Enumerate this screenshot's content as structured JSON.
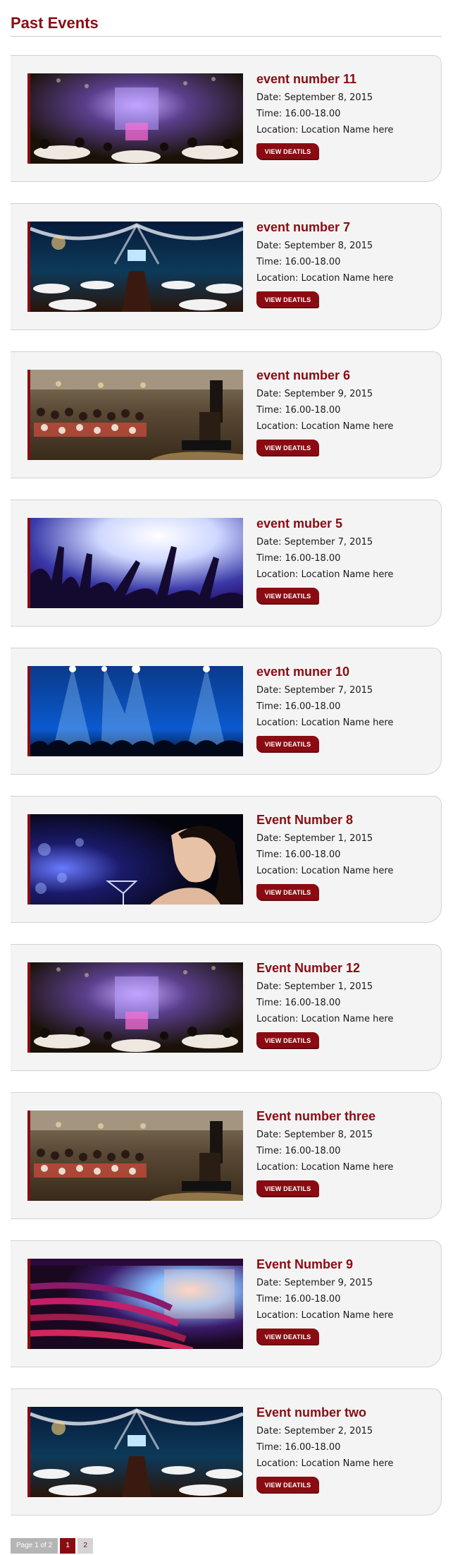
{
  "page": {
    "title": "Past Events"
  },
  "events": [
    {
      "title": "event number 11",
      "date": "Date: September 8, 2015",
      "time": "Time: 16.00-18.00",
      "location": "Location: Location Name here",
      "button": "VIEW DEATILS",
      "image": "banquet-hall"
    },
    {
      "title": "event number 7",
      "date": "Date: September 8, 2015",
      "time": "Time: 16.00-18.00",
      "location": "Location: Location Name here",
      "button": "VIEW DEATILS",
      "image": "tent-gala"
    },
    {
      "title": "event number 6",
      "date": "Date: September 9, 2015",
      "time": "Time: 16.00-18.00",
      "location": "Location: Location Name here",
      "button": "VIEW DEATILS",
      "image": "conference-room"
    },
    {
      "title": "event muber 5",
      "date": "Date: September 7, 2015",
      "time": "Time: 16.00-18.00",
      "location": "Location: Location Name here",
      "button": "VIEW DEATILS",
      "image": "concert-crowd"
    },
    {
      "title": "event muner 10",
      "date": "Date: September 7, 2015",
      "time": "Time: 16.00-18.00",
      "location": "Location: Location Name here",
      "button": "VIEW DEATILS",
      "image": "stage-lights"
    },
    {
      "title": "Event Number 8",
      "date": "Date: September 1, 2015",
      "time": "Time: 16.00-18.00",
      "location": "Location: Location Name here",
      "button": "VIEW DEATILS",
      "image": "woman-cocktail"
    },
    {
      "title": "Event Number 12",
      "date": "Date: September 1, 2015",
      "time": "Time: 16.00-18.00",
      "location": "Location: Location Name here",
      "button": "VIEW DEATILS",
      "image": "banquet-hall"
    },
    {
      "title": "Event number three",
      "date": "Date: September 8, 2015",
      "time": "Time: 16.00-18.00",
      "location": "Location: Location Name here",
      "button": "VIEW DEATILS",
      "image": "conference-room"
    },
    {
      "title": "Event Number 9",
      "date": "Date: September 9, 2015",
      "time": "Time: 16.00-18.00",
      "location": "Location: Location Name here",
      "button": "VIEW DEATILS",
      "image": "theater"
    },
    {
      "title": "Event number two",
      "date": "Date: September 2, 2015",
      "time": "Time: 16.00-18.00",
      "location": "Location: Location Name here",
      "button": "VIEW DEATILS",
      "image": "tent-gala"
    }
  ],
  "pagination": {
    "info": "Page 1 of 2",
    "pages": [
      "1",
      "2"
    ],
    "current": "1"
  },
  "colors": {
    "accent": "#8a0c12",
    "card_bg": "#f4f4f4"
  }
}
